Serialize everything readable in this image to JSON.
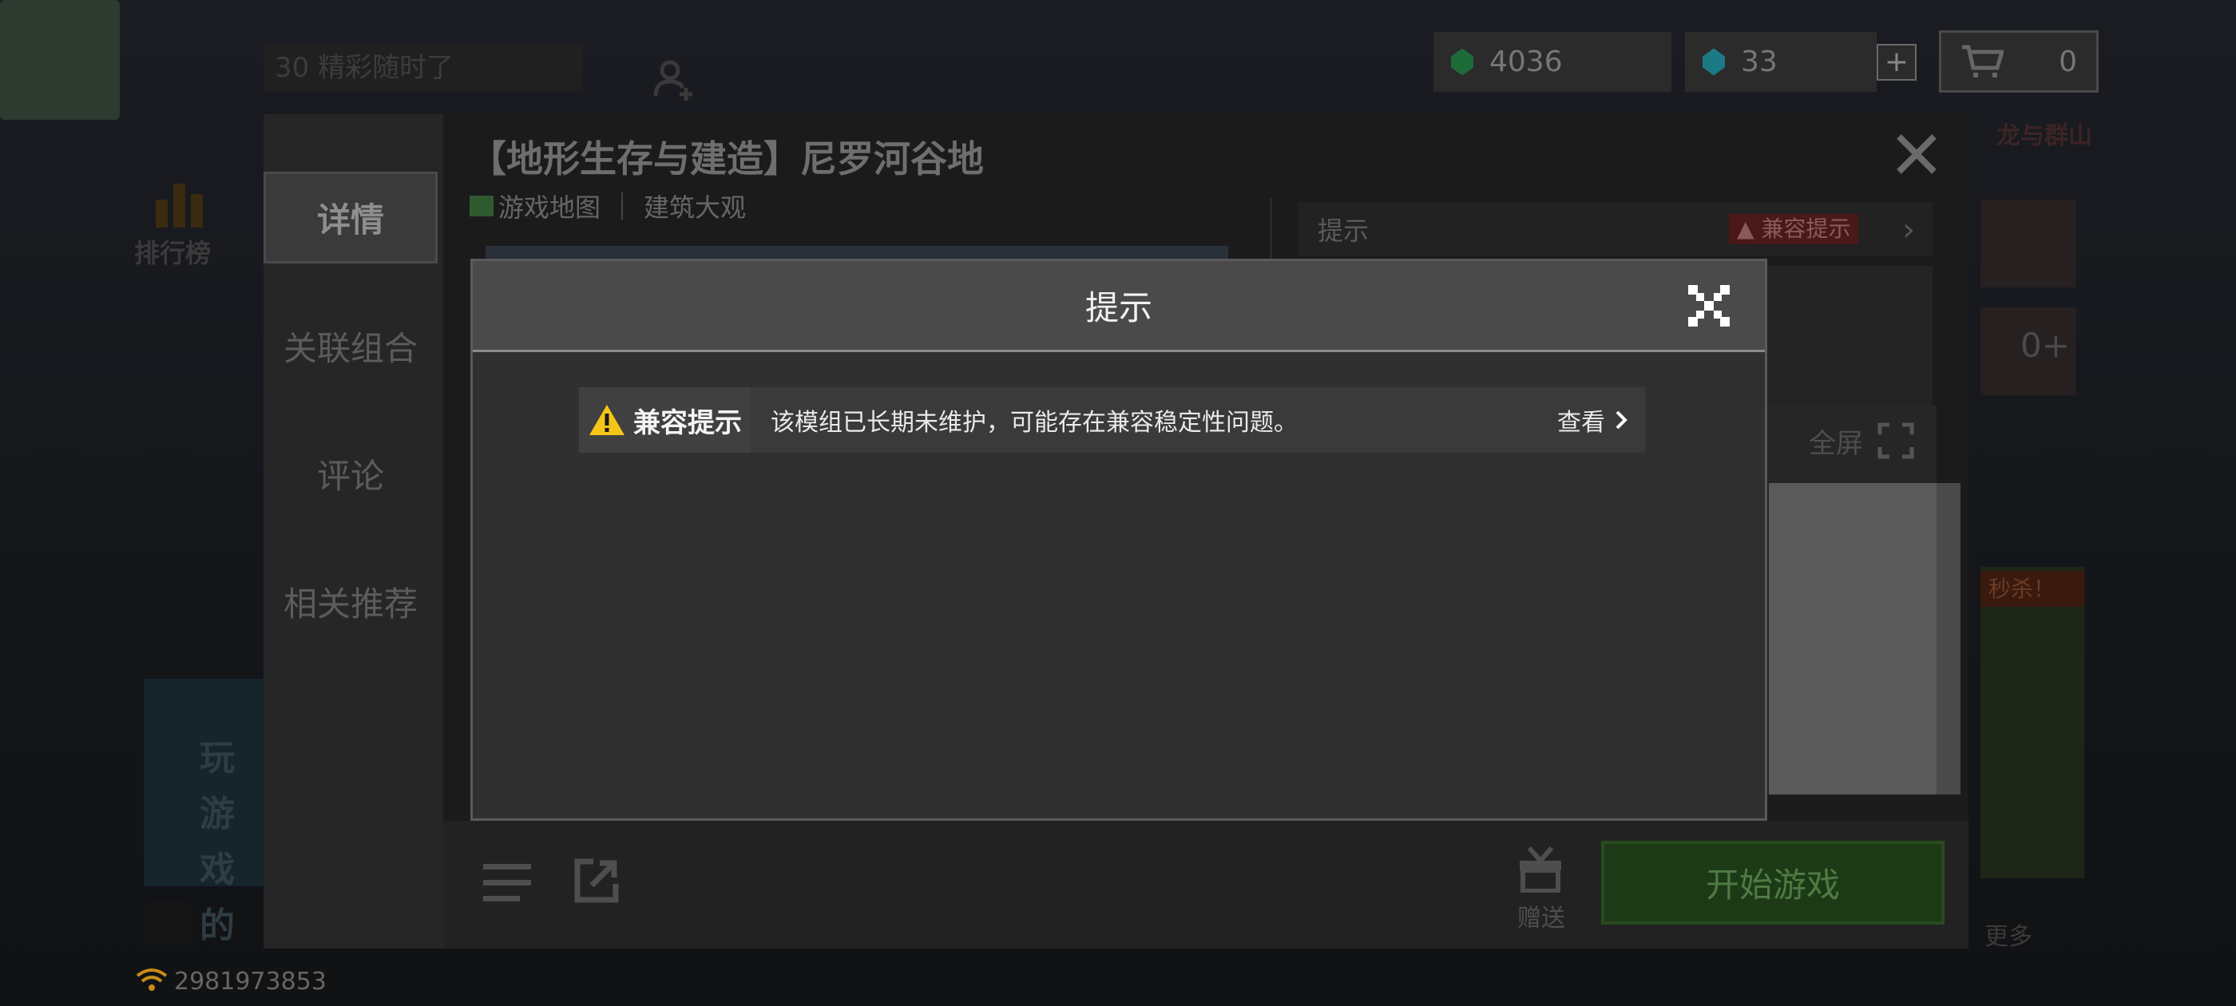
{
  "background": {
    "event_title": "30 精彩随时了",
    "rank_label": "排行榜",
    "dragon_label": "龙与群山",
    "promo_tag": "秒杀！",
    "banner_text": "玩游戏的",
    "more_label": "更多",
    "player_id": "2981973853"
  },
  "currency": {
    "emerald_count": "4036",
    "diamond_count": "33",
    "add_label": "+",
    "cart_count": "0"
  },
  "detail": {
    "title": "【地形生存与建造】尼罗河谷地",
    "sidebar_tabs": [
      "详情",
      "关联组合",
      "评论",
      "相关推荐"
    ],
    "subtabs": {
      "game_map": "游戏地图",
      "buildings": "建筑大观"
    },
    "tips_label": "提示",
    "compat_badge": "兼容提示",
    "stat_value_partial": "0+",
    "fullscreen_label": "全屏",
    "gift_label": "赠送",
    "start_game_label": "开始游戏"
  },
  "modal": {
    "title": "提示",
    "compat_tag": "兼容提示",
    "compat_message": "该模组已长期未维护，可能存在兼容稳定性问题。",
    "view_label": "查看"
  },
  "colors": {
    "modal_header": "#4a4a4a",
    "modal_body": "#303030",
    "warning_yellow": "#f5c518",
    "start_button_green": "#1d3a16"
  }
}
